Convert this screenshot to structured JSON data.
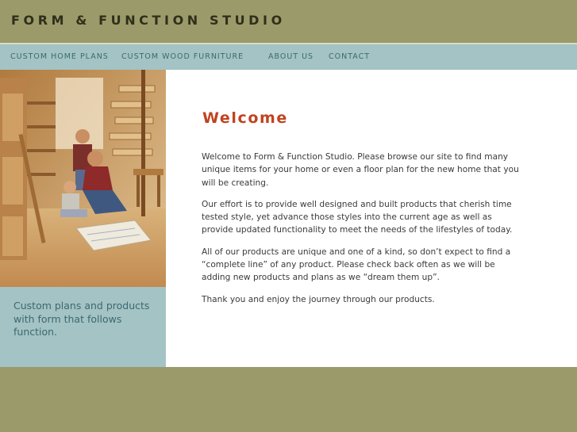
{
  "site": {
    "title": "FORM & FUNCTION STUDIO"
  },
  "nav": {
    "items": [
      {
        "label": "CUSTOM HOME PLANS"
      },
      {
        "label": "CUSTOM WOOD FURNITURE"
      },
      {
        "label": "ABOUT US"
      },
      {
        "label": "CONTACT"
      }
    ]
  },
  "sidebar": {
    "photo_icon": "family-woodshop-photo",
    "caption": "Custom plans and products with form that follows function."
  },
  "main": {
    "heading": "Welcome",
    "paragraphs": [
      "Welcome to Form & Function Studio. Please browse our site to find many unique items for your home or even a floor plan for the new home that you will be creating.",
      "Our effort is to provide well designed and built products that cherish time tested style, yet advance those styles into the current age as well as provide updated functionality to meet the needs of the lifestyles of today.",
      "All of our products are unique and one of a kind, so don’t expect to find a “complete line” of any product. Please check back often as we will be adding new products and plans as we “dream them up”.",
      "Thank you and enjoy the journey through our products."
    ]
  },
  "colors": {
    "olive": "#9b9a6a",
    "teal": "#a3c3c4",
    "heading_red": "#c0431f",
    "nav_text": "#3c6a6e"
  }
}
